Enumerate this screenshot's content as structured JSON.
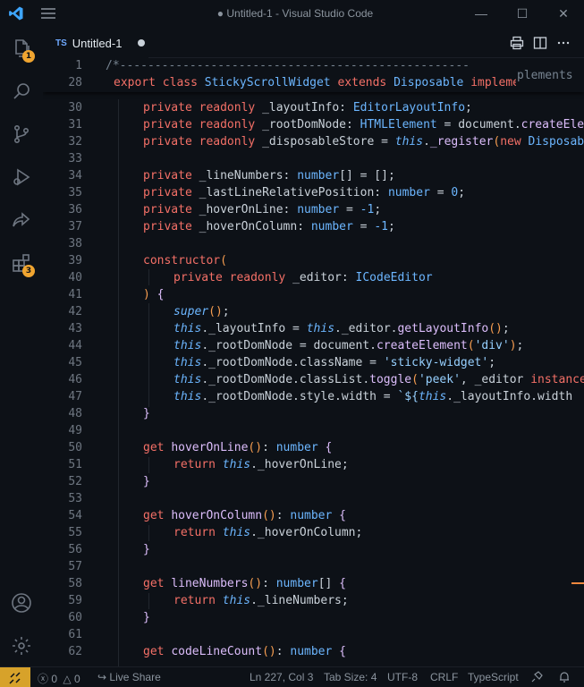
{
  "window": {
    "title": "● Untitled-1 - Visual Studio Code",
    "minimize": "—",
    "maximize": "☐",
    "close": "✕"
  },
  "activity_bar": {
    "explorer_badge": "1",
    "extensions_badge": "3"
  },
  "tab": {
    "lang": "TS",
    "name": "Untitled-1"
  },
  "sticky": {
    "line1_num": "1",
    "line1_text": "/*--------------------------------------------------",
    "line1_overflow": "plements",
    "line2_num": "28"
  },
  "lines": [
    {
      "n": "30"
    },
    {
      "n": "31"
    },
    {
      "n": "32"
    },
    {
      "n": "33"
    },
    {
      "n": "34"
    },
    {
      "n": "35"
    },
    {
      "n": "36"
    },
    {
      "n": "37"
    },
    {
      "n": "38"
    },
    {
      "n": "39"
    },
    {
      "n": "40"
    },
    {
      "n": "41"
    },
    {
      "n": "42"
    },
    {
      "n": "43"
    },
    {
      "n": "44"
    },
    {
      "n": "45"
    },
    {
      "n": "46"
    },
    {
      "n": "47"
    },
    {
      "n": "48"
    },
    {
      "n": "49"
    },
    {
      "n": "50"
    },
    {
      "n": "51"
    },
    {
      "n": "52"
    },
    {
      "n": "53"
    },
    {
      "n": "54"
    },
    {
      "n": "55"
    },
    {
      "n": "56"
    },
    {
      "n": "57"
    },
    {
      "n": "58"
    },
    {
      "n": "59"
    },
    {
      "n": "60"
    },
    {
      "n": "61"
    },
    {
      "n": "62"
    }
  ],
  "status": {
    "errors": "0",
    "warnings": "0",
    "live_share": "Live Share",
    "position": "Ln 227, Col 3",
    "tab_size": "Tab Size: 4",
    "encoding": "UTF-8",
    "eol": "CRLF",
    "language": "TypeScript"
  },
  "colors": {
    "accent": "#d7a22a",
    "background": "#0d1117"
  }
}
